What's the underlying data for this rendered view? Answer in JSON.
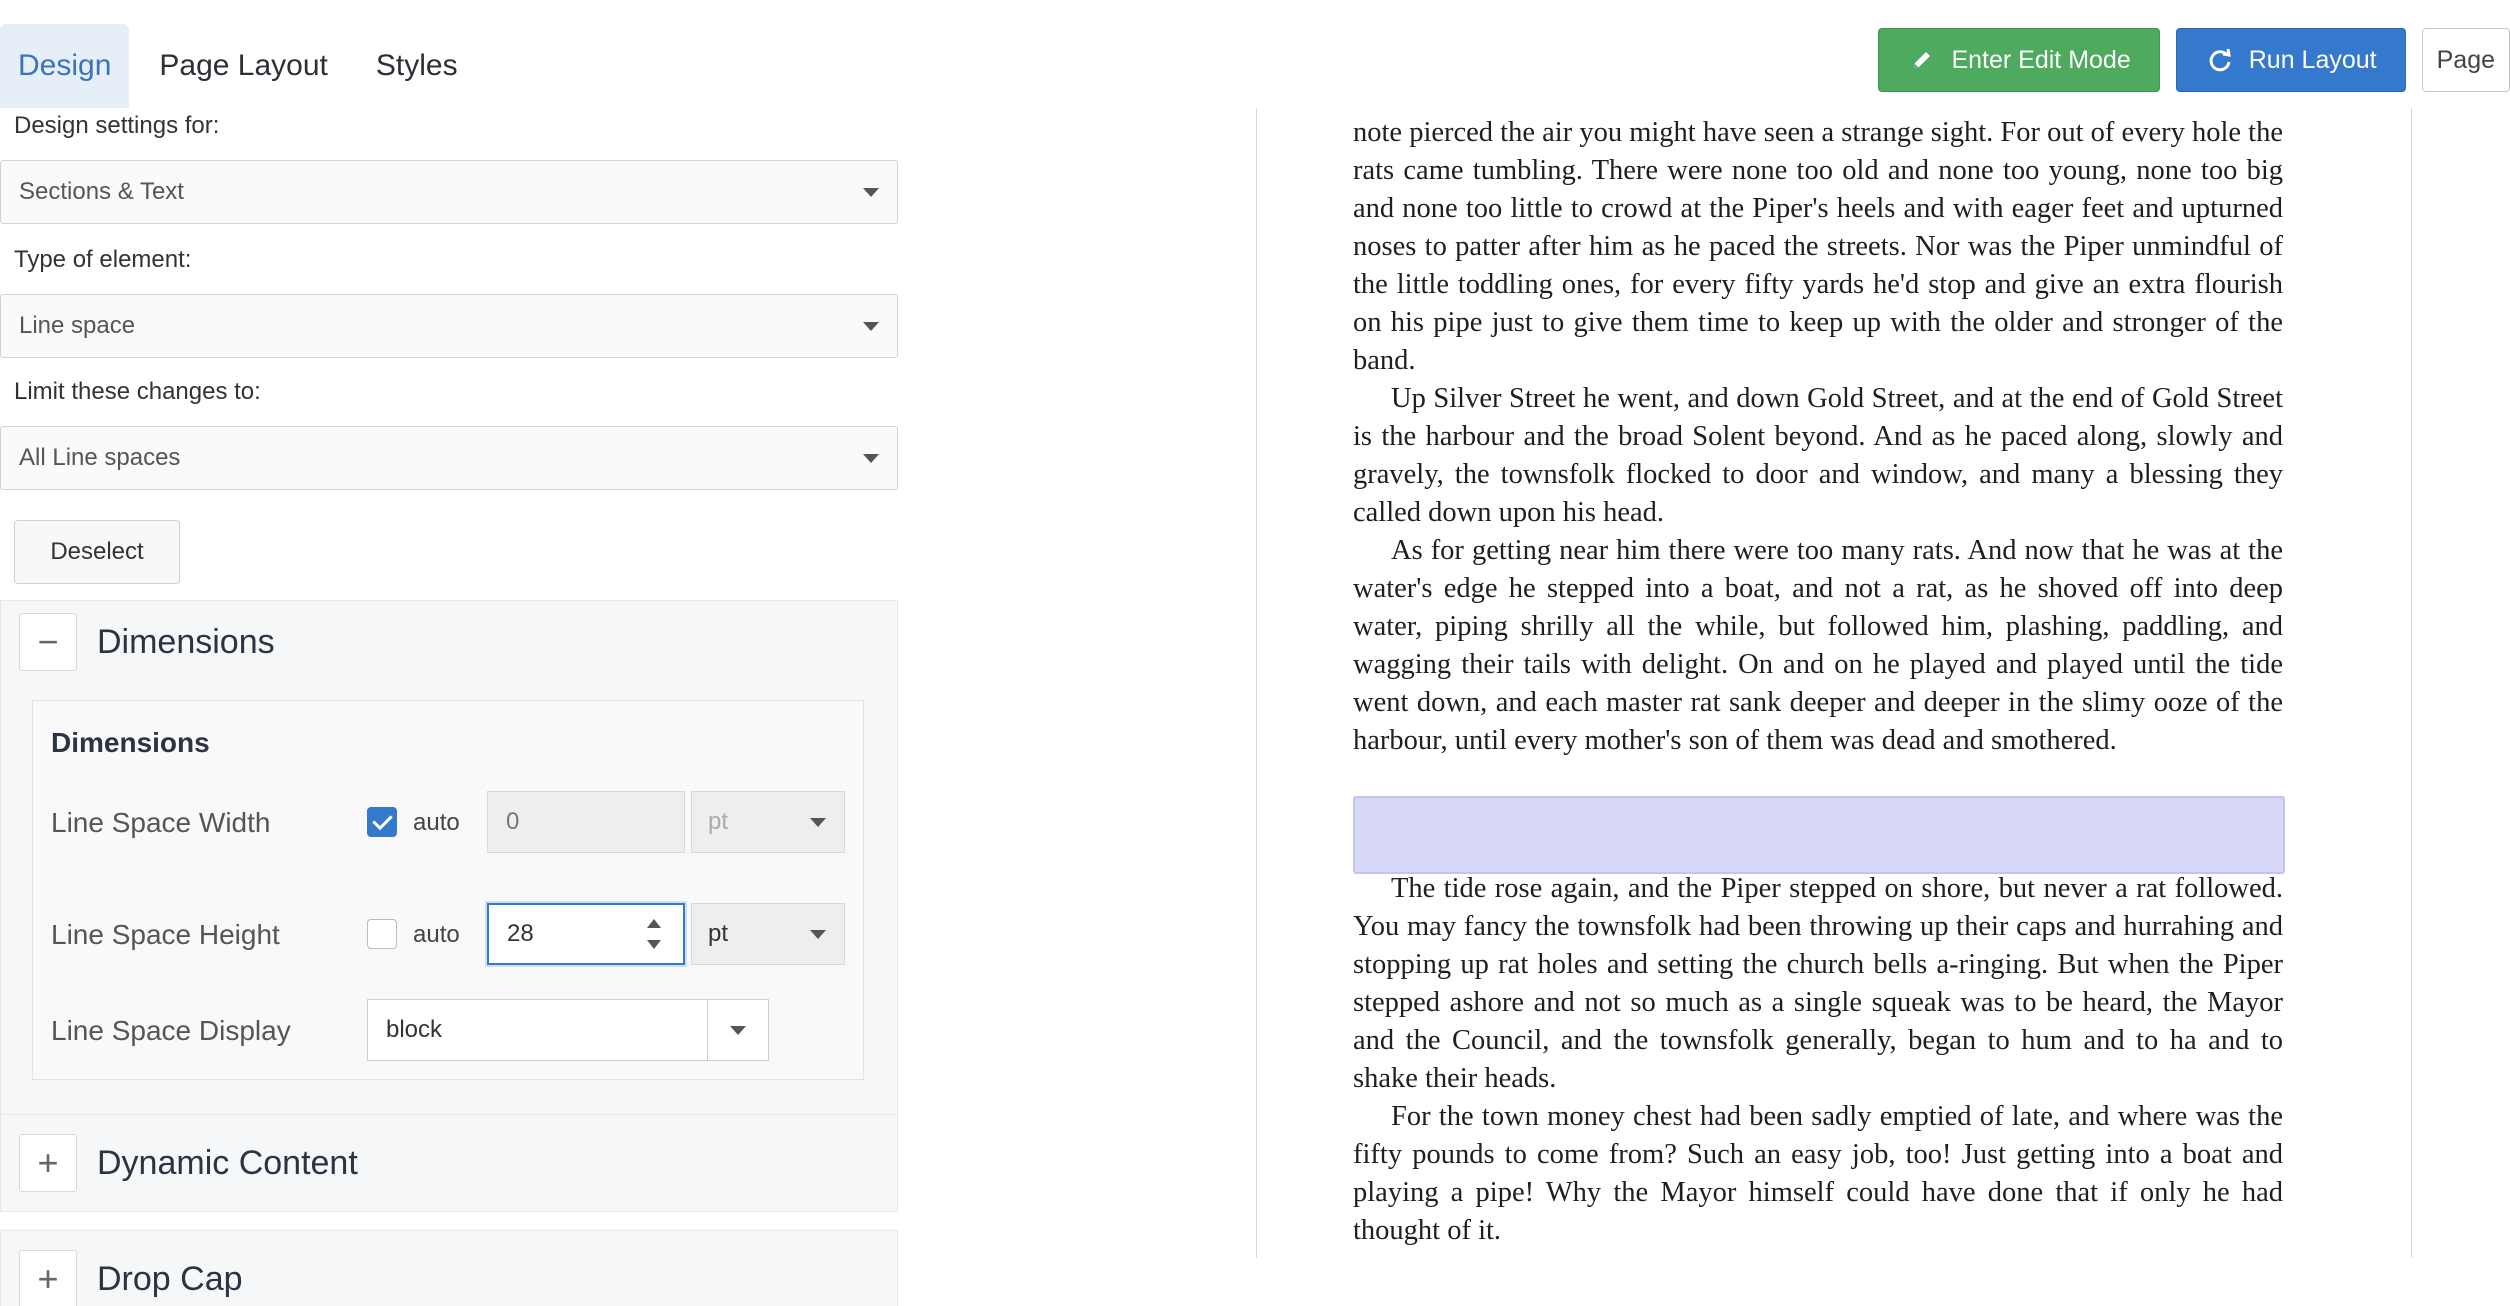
{
  "tabs": [
    {
      "label": "Design"
    },
    {
      "label": "Page Layout"
    },
    {
      "label": "Styles"
    }
  ],
  "toolbar": {
    "edit_label": "Enter Edit Mode",
    "run_label": "Run Layout",
    "page_label": "Page",
    "colors": {
      "edit": "#4daa5f",
      "run": "#3479cb"
    }
  },
  "settings": {
    "design_for_label": "Design settings for:",
    "design_for_value": "Sections & Text",
    "element_type_label": "Type of element:",
    "element_type_value": "Line space",
    "limit_label": "Limit these changes to:",
    "limit_value": "All Line spaces",
    "deselect_label": "Deselect"
  },
  "dimensions": {
    "header": "Dimensions",
    "title": "Dimensions",
    "toggle": "−",
    "width_label": "Line Space Width",
    "width_auto_label": "auto",
    "width_auto_checked": true,
    "width_value": "0",
    "width_unit": "pt",
    "height_label": "Line Space Height",
    "height_auto_label": "auto",
    "height_auto_checked": false,
    "height_value": "28",
    "height_unit": "pt",
    "display_label": "Line Space Display",
    "display_value": "block"
  },
  "sections": [
    {
      "toggle": "+",
      "title": "Dynamic Content"
    },
    {
      "toggle": "+",
      "title": "Drop Cap"
    }
  ],
  "preview": {
    "para1": "note pierced the air you might have seen a strange sight. For out of every hole the rats came tumbling. There were none too old and none too young, none too big and none too little to crowd at the Piper's heels and with eager feet and upturned noses to patter after him as he paced the streets. Nor was the Piper unmindful of the little toddling ones, for every fifty yards he'd stop and give an extra flourish on his pipe just to give them time to keep up with the older and stronger of the band.",
    "para2": "Up Silver Street he went, and down Gold Street, and at the end of Gold Street is the harbour and the broad Solent beyond. And as he paced along, slowly and gravely, the townsfolk flocked to door and window, and many a blessing they called down upon his head.",
    "para3": "As for getting near him there were too many rats. And now that he was at the water's edge he stepped into a boat, and not a rat, as he shoved off into deep water, piping shrilly all the while, but followed him, plashing, paddling, and wagging their tails with delight. On and on he played and played until the tide went down, and each master rat sank deeper and deeper in the slimy ooze of the harbour, until every mother's son of them was dead and smothered.",
    "para4": "The tide rose again, and the Piper stepped on shore, but never a rat fol­lowed. You may fancy the townsfolk had been throwing up their caps and hurrahing and stopping up rat holes and setting the church bells a-ringing. But when the Piper stepped ashore and not so much as a single squeak was to be heard, the Mayor and the Council, and the townsfolk generally, began to hum and to ha and to shake their heads.",
    "para5": "For the town money chest had been sadly emptied of late, and where was the fifty pounds to come from? Such an easy job, too! Just getting into a boat and playing a pipe! Why the Mayor himself could have done that if only he had thought of it.",
    "highlight_color": "#d6d8f5"
  }
}
